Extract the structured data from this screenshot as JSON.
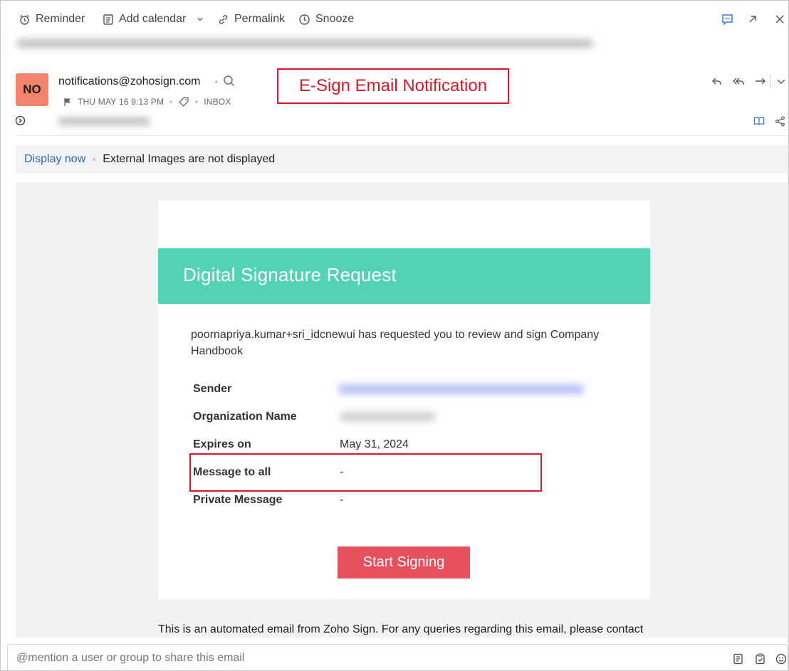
{
  "toolbar": {
    "reminder_label": "Reminder",
    "add_calendar_label": "Add calendar",
    "permalink_label": "Permalink",
    "snooze_label": "Snooze"
  },
  "header": {
    "avatar_initials": "NO",
    "avatar_color": "#f3826d",
    "from_address": "notifications@zohosign.com",
    "date_time": "THU MAY 16 9:13 PM",
    "folder": "INBOX"
  },
  "annotation": {
    "label": "E-Sign Email Notification",
    "color": "#d9182a"
  },
  "images_bar": {
    "display_now": "Display now",
    "message": "External Images are not displayed"
  },
  "email": {
    "banner_title": "Digital Signature Request",
    "banner_color": "#52d3b6",
    "request_text": "poornapriya.kumar+sri_idcnewui has requested you to review and sign Company Handbook",
    "rows": [
      {
        "label": "Sender",
        "value": ""
      },
      {
        "label": "Organization Name",
        "value": ""
      },
      {
        "label": "Expires on",
        "value": "May 31, 2024"
      },
      {
        "label": "Message to all",
        "value": "-"
      },
      {
        "label": "Private Message",
        "value": "-"
      }
    ],
    "button_label": "Start Signing",
    "button_color": "#e8505b",
    "footer_text": "This is an automated email from Zoho Sign. For any queries regarding this email, please contact"
  },
  "comment": {
    "placeholder": "@mention a user or group to share this email"
  },
  "icons": [
    "alarm-icon",
    "calendar-icon",
    "chevron-down-icon",
    "link-icon",
    "clock-icon",
    "chat-icon",
    "expand-icon",
    "close-icon",
    "search-icon",
    "flag-icon",
    "tag-icon",
    "reply-icon",
    "reply-all-icon",
    "forward-icon",
    "book-icon",
    "share-icon",
    "note-icon",
    "task-icon",
    "emoji-icon"
  ]
}
